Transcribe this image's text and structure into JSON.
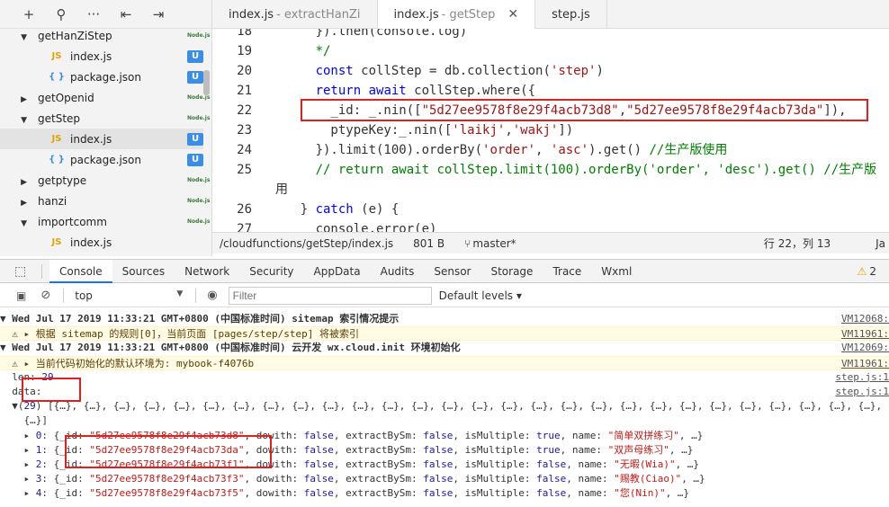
{
  "sidebar": {
    "toolbar": [
      "+",
      "⚲",
      "···",
      "⇤",
      "⇥"
    ],
    "tree": [
      {
        "label": "getHanZiStep",
        "kind": "folder",
        "expanded": true,
        "level": 1,
        "badge": "Node.js"
      },
      {
        "label": "index.js",
        "kind": "js",
        "level": 2,
        "badge": "U"
      },
      {
        "label": "package.json",
        "kind": "json",
        "level": 2,
        "badge": "U"
      },
      {
        "label": "getOpenid",
        "kind": "folder",
        "expanded": false,
        "level": 1,
        "badge": "Node.js"
      },
      {
        "label": "getStep",
        "kind": "folder",
        "expanded": true,
        "level": 1,
        "badge": "Node.js"
      },
      {
        "label": "index.js",
        "kind": "js",
        "level": 2,
        "badge": "U",
        "selected": true
      },
      {
        "label": "package.json",
        "kind": "json",
        "level": 2,
        "badge": "U"
      },
      {
        "label": "getptype",
        "kind": "folder",
        "expanded": false,
        "level": 1,
        "badge": "Node.js"
      },
      {
        "label": "hanzi",
        "kind": "folder",
        "expanded": false,
        "level": 1,
        "badge": "Node.js"
      },
      {
        "label": "importcomm",
        "kind": "folder",
        "expanded": true,
        "level": 1,
        "badge": "Node.js"
      },
      {
        "label": "index.js",
        "kind": "js",
        "level": 2,
        "badge": ""
      }
    ]
  },
  "editor": {
    "tabs": [
      {
        "name": "index.js",
        "sub": "- extractHanZi",
        "active": false
      },
      {
        "name": "index.js",
        "sub": "- getStep",
        "active": true,
        "close": "✕"
      },
      {
        "name": "step.js",
        "sub": "",
        "active": false
      }
    ],
    "lines": [
      {
        "n": "18",
        "t": "      }).then(console.log)"
      },
      {
        "n": "19",
        "t": "      */"
      },
      {
        "n": "20",
        "t": "      const collStep = db.collection('step')"
      },
      {
        "n": "21",
        "t": "      return await collStep.where({"
      },
      {
        "n": "22",
        "t": "        _id: _.nin([\"5d27ee9578f8e29f4acb73d8\",\"5d27ee9578f8e29f4acb73da\"]),"
      },
      {
        "n": "23",
        "t": "        ptypeKey:_.nin(['laikj','wakj'])"
      },
      {
        "n": "24",
        "t": "      }).limit(100).orderBy('order', 'asc').get() //生产版使用"
      },
      {
        "n": "25",
        "t": "      // return await collStep.limit(100).orderBy('order', 'desc').get() //生产版"
      },
      {
        "n": "",
        "t": "用"
      },
      {
        "n": "26",
        "t": "    } catch (e) {"
      },
      {
        "n": "27",
        "t": "      console.error(e)"
      }
    ],
    "status": {
      "path": "/cloudfunctions/getStep/index.js",
      "size": "801 B",
      "branch": "master*",
      "pos": "行 22，列 13",
      "lang": "Ja"
    }
  },
  "devtools": {
    "tabs": [
      "Console",
      "Sources",
      "Network",
      "Security",
      "AppData",
      "Audits",
      "Sensor",
      "Storage",
      "Trace",
      "Wxml"
    ],
    "active_tab": "Console",
    "warn_count": "2",
    "context": "top",
    "filter_placeholder": "Filter",
    "levels": "Default levels ▾"
  },
  "console": [
    {
      "type": "group",
      "text": "▼ Wed Jul 17 2019 11:33:21 GMT+0800 (中国标准时间) sitemap 索引情况提示",
      "src": "VM12068:"
    },
    {
      "type": "warn",
      "text": "  ⚠ ▸ 根据 sitemap 的规则[0]，当前页面 [pages/step/step] 将被索引",
      "src": "VM11961:"
    },
    {
      "type": "group",
      "text": "▼ Wed Jul 17 2019 11:33:21 GMT+0800 (中国标准时间) 云开发 wx.cloud.init 环境初始化",
      "src": "VM12069:"
    },
    {
      "type": "warn",
      "text": "  ⚠ ▸ 当前代码初始化的默认环境为: mybook-f4076b",
      "src": "VM11961:"
    },
    {
      "type": "log",
      "text": "  len: 29",
      "src": "step.js:1"
    },
    {
      "type": "log",
      "text": "  data:",
      "src": "step.js:1"
    },
    {
      "type": "log",
      "text": "  ▼(29) [{…}, {…}, {…}, {…}, {…}, {…}, {…}, {…}, {…}, {…}, {…}, {…}, {…}, {…}, {…}, {…}, {…}, {…}, {…}, {…}, {…}, {…}, {…}, {…}, {…}, {…}, {…}, {…}, {…}]",
      "src": ""
    },
    {
      "type": "log",
      "text": "    {…}]",
      "src": ""
    },
    {
      "type": "obj",
      "text": "    ▸ 0: {_id: \"5d27ee9578f8e29f4acb73d8\", dowith: false, extractBySm: false, isMultiple: true, name: \"简单双拼练习\", …}",
      "src": ""
    },
    {
      "type": "obj",
      "text": "    ▸ 1: {_id: \"5d27ee9578f8e29f4acb73da\", dowith: false, extractBySm: false, isMultiple: true, name: \"双声母练习\", …}",
      "src": ""
    },
    {
      "type": "obj",
      "text": "    ▸ 2: {_id: \"5d27ee9578f8e29f4acb73f1\", dowith: false, extractBySm: false, isMultiple: false, name: \"无暇(Wia)\", …}",
      "src": ""
    },
    {
      "type": "obj",
      "text": "    ▸ 3: {_id: \"5d27ee9578f8e29f4acb73f3\", dowith: false, extractBySm: false, isMultiple: false, name: \"赐教(Ciao)\", …}",
      "src": ""
    },
    {
      "type": "obj",
      "text": "    ▸ 4: {_id: \"5d27ee9578f8e29f4acb73f5\", dowith: false, extractBySm: false, isMultiple: false, name: \"您(Nin)\", …}",
      "src": ""
    }
  ],
  "colors": {
    "highlight": "#e02020",
    "accent": "#1a73e8",
    "badge_u": "#3a8ee6"
  }
}
